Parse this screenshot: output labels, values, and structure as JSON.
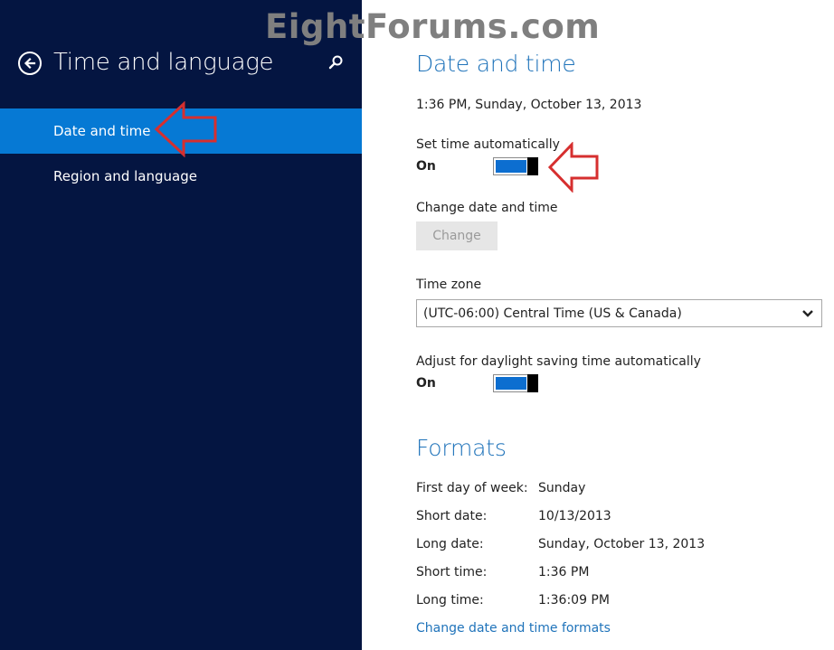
{
  "watermark": "EightForums.com",
  "sidebar": {
    "title": "Time and language",
    "items": [
      {
        "label": "Date and time",
        "selected": true
      },
      {
        "label": "Region and language",
        "selected": false
      }
    ]
  },
  "main": {
    "date_time_heading": "Date and time",
    "current_datetime": "1:36 PM, Sunday, October 13, 2013",
    "set_time_auto": {
      "label": "Set time automatically",
      "state": "On"
    },
    "change_date_time": {
      "label": "Change date and time",
      "button": "Change"
    },
    "time_zone": {
      "label": "Time zone",
      "value": "(UTC-06:00) Central Time (US & Canada)"
    },
    "daylight": {
      "label": "Adjust for daylight saving time automatically",
      "state": "On"
    },
    "formats_heading": "Formats",
    "formats": [
      {
        "label": "First day of week:",
        "value": "Sunday"
      },
      {
        "label": "Short date:",
        "value": "10/13/2013"
      },
      {
        "label": "Long date:",
        "value": "Sunday, October 13, 2013"
      },
      {
        "label": "Short time:",
        "value": "1:36 PM"
      },
      {
        "label": "Long time:",
        "value": "1:36:09 PM"
      }
    ],
    "formats_link": "Change date and time formats"
  },
  "colors": {
    "sidebar_bg": "#041541",
    "selected_bg": "#0679d4",
    "accent": "#1f73ba",
    "toggle_fill": "#0c6ed0",
    "annotation": "#d62f2f"
  },
  "icons": [
    "back-arrow-icon",
    "search-icon",
    "chevron-down-icon",
    "annotation-arrow-icon"
  ]
}
